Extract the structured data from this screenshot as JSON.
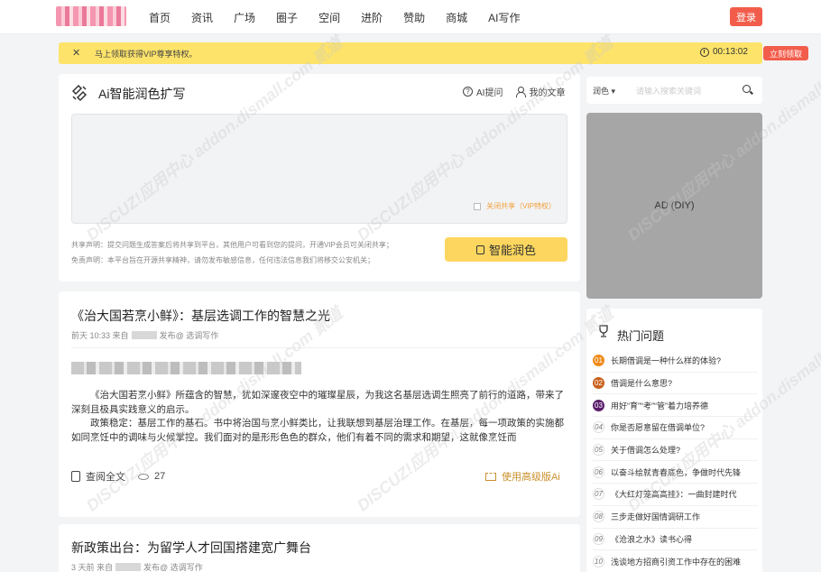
{
  "header": {
    "nav": [
      "首页",
      "资讯",
      "广场",
      "圈子",
      "空间",
      "进阶",
      "赞助",
      "商城",
      "AI写作"
    ],
    "login_label": "登录"
  },
  "vip_banner": {
    "close_glyph": "✕",
    "text": "马上领取获得VIP尊享特权。",
    "timer": "00:13:02",
    "claim_label": "立刻领取",
    "color": "#fde36a"
  },
  "ai_panel": {
    "title": "Ai智能润色扩写",
    "ask_label": "AI提问",
    "my_articles_label": "我的文章",
    "share_toggle_label": "关闭共享（VIP特权）",
    "disclaimer_share": "共享声明：提交问题生成答案后将共享到平台，其他用户可看到您的提问，开通VIP会员可关闭共享；",
    "disclaimer_free": "免责声明：本平台旨在开源共享精神，请勿发布敏感信息，任何违法信息我们将移交公安机关；",
    "polish_label": "智能润色",
    "accent": "#fcd65e"
  },
  "articles": [
    {
      "title": "《治大国若烹小鲜》：基层选调工作的智慧之光",
      "time": "前天 10:33",
      "from_label": "来自",
      "posted_label": "发布@",
      "category": "选调写作",
      "body": [
        "《治大国若烹小鲜》所蕴含的智慧，犹如深邃夜空中的璀璨星辰，为我这名基层选调生照亮了前行的道路，带来了深刻且极具实践意义的启示。",
        "政策稳定：基层工作的基石。书中将治国与烹小鲜类比，让我联想到基层治理工作。在基层，每一项政策的实施都如同烹饪中的调味与火候掌控。我们面对的是形形色色的群众，他们有着不同的需求和期望，这就像烹饪而"
      ],
      "read_label": "查阅全文",
      "views": "27",
      "advanced_label": "使用高级版Ai"
    },
    {
      "title": "新政策出台：为留学人才回国搭建宽广舞台",
      "time": "3 天前",
      "from_label": "来自",
      "posted_label": "发布@",
      "category": "选调写作"
    }
  ],
  "sidebar": {
    "search_select": "润色",
    "search_placeholder": "请输入搜索关键词",
    "ad_label": "AD (DIY)",
    "hot_title": "热门问题",
    "hot_items": [
      {
        "num": "01",
        "text": "长期借调是一种什么样的体验?"
      },
      {
        "num": "02",
        "text": "借调是什么意思?"
      },
      {
        "num": "03",
        "text": "用好“育”“考”“管”着力培养德"
      },
      {
        "num": "04",
        "text": "你是否愿意留在借调单位?"
      },
      {
        "num": "05",
        "text": "关于借调怎么处理?"
      },
      {
        "num": "06",
        "text": "以奋斗绘就青春底色，争做时代先锋"
      },
      {
        "num": "07",
        "text": "《大红灯笼高高挂》：一曲封建时代"
      },
      {
        "num": "08",
        "text": "三步走做好国情调研工作"
      },
      {
        "num": "09",
        "text": "《沧浪之水》读书心得"
      },
      {
        "num": "10",
        "text": "浅谈地方招商引资工作中存在的困难"
      }
    ]
  },
  "watermark": "DISCUZ!应用中心 addon.dismall.com 贰道"
}
